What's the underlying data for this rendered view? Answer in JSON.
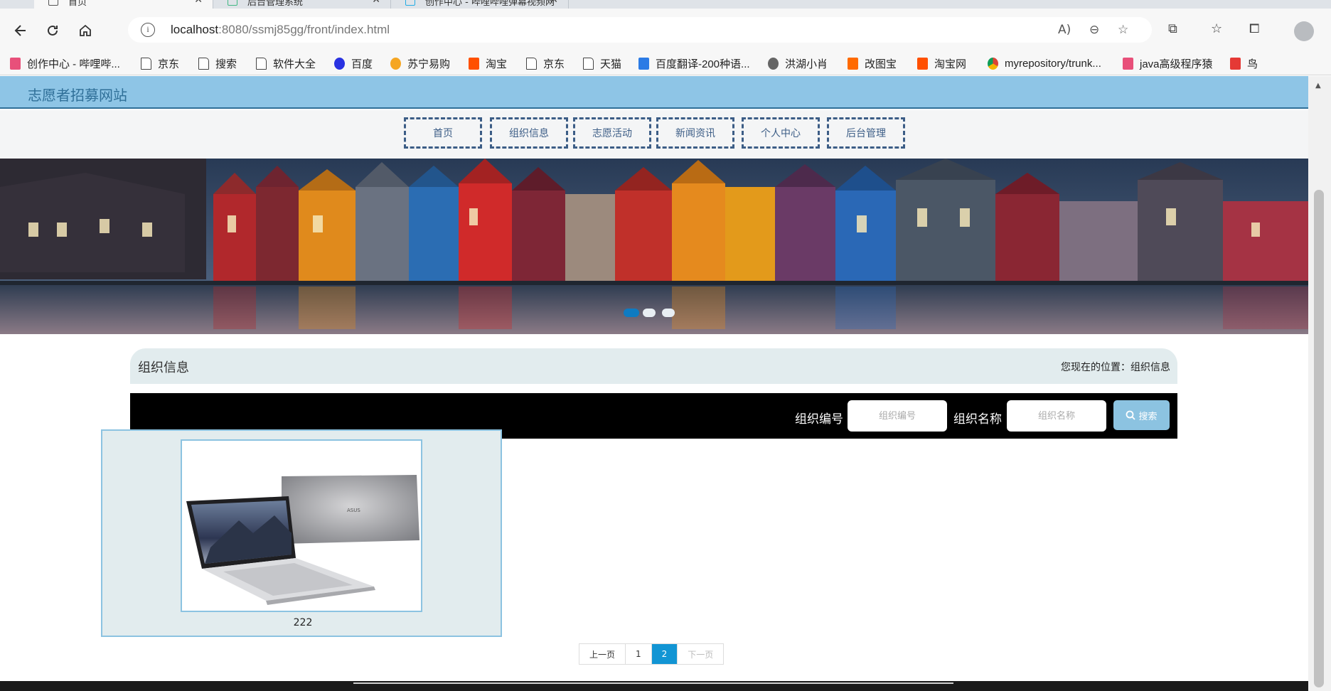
{
  "browser": {
    "tabs": [
      {
        "title": "首页",
        "active": true
      },
      {
        "title": "后台管理系统",
        "active": false
      },
      {
        "title": "创作中心 - 哔哩哔哩弹幕视频网",
        "active": false
      }
    ],
    "url_host": "localhost",
    "url_rest": ":8080/ssmj85gg/front/index.html",
    "bookmarks": [
      {
        "label": "创作中心 - 哔哩哔...",
        "icon": "bilibili-icon",
        "color": "#e8507a"
      },
      {
        "label": "京东",
        "icon": "page-icon"
      },
      {
        "label": "搜索",
        "icon": "page-icon"
      },
      {
        "label": "软件大全",
        "icon": "page-icon"
      },
      {
        "label": "百度",
        "icon": "baidu-icon",
        "color": "#2932e1"
      },
      {
        "label": "苏宁易购",
        "icon": "suning-icon",
        "color": "#f5a623"
      },
      {
        "label": "淘宝",
        "icon": "taobao-icon",
        "color": "#ff5000"
      },
      {
        "label": "京东",
        "icon": "page-icon"
      },
      {
        "label": "天猫",
        "icon": "page-icon"
      },
      {
        "label": "百度翻译-200种语...",
        "icon": "translate-icon",
        "color": "#2c7be5"
      },
      {
        "label": "洪湖小肖",
        "icon": "hh-icon",
        "color": "#666666"
      },
      {
        "label": "改图宝",
        "icon": "gaitubao-icon",
        "color": "#ff6a00"
      },
      {
        "label": "淘宝网",
        "icon": "taobao-icon",
        "color": "#ff5000"
      },
      {
        "label": "myrepository/trunk...",
        "icon": "chrome-icon",
        "color": "#db4437"
      },
      {
        "label": "java高级程序猿",
        "icon": "bilibili-icon",
        "color": "#e8507a"
      },
      {
        "label": "鸟",
        "icon": "bird-icon",
        "color": "#e53935"
      }
    ]
  },
  "site": {
    "title": "志愿者招募网站",
    "nav": [
      "首页",
      "组织信息",
      "志愿活动",
      "新闻资讯",
      "个人中心",
      "后台管理"
    ]
  },
  "banner": {
    "slides": 3,
    "active_slide": 1
  },
  "section": {
    "title": "组织信息",
    "breadcrumb": "您现在的位置：组织信息"
  },
  "search": {
    "label1": "组织编号",
    "placeholder1": "组织编号",
    "label2": "组织名称",
    "placeholder2": "组织名称",
    "button": "搜索"
  },
  "items": [
    {
      "name": "222",
      "image": "laptop"
    }
  ],
  "pagination": {
    "prev": "上一页",
    "pages": [
      "1",
      "2"
    ],
    "current": "2",
    "next": "下一页"
  },
  "colors": {
    "header": "#8ec5e6",
    "nav_border": "#3c5d86",
    "accent": "#1295d4",
    "card_bg": "#e2ecee"
  }
}
